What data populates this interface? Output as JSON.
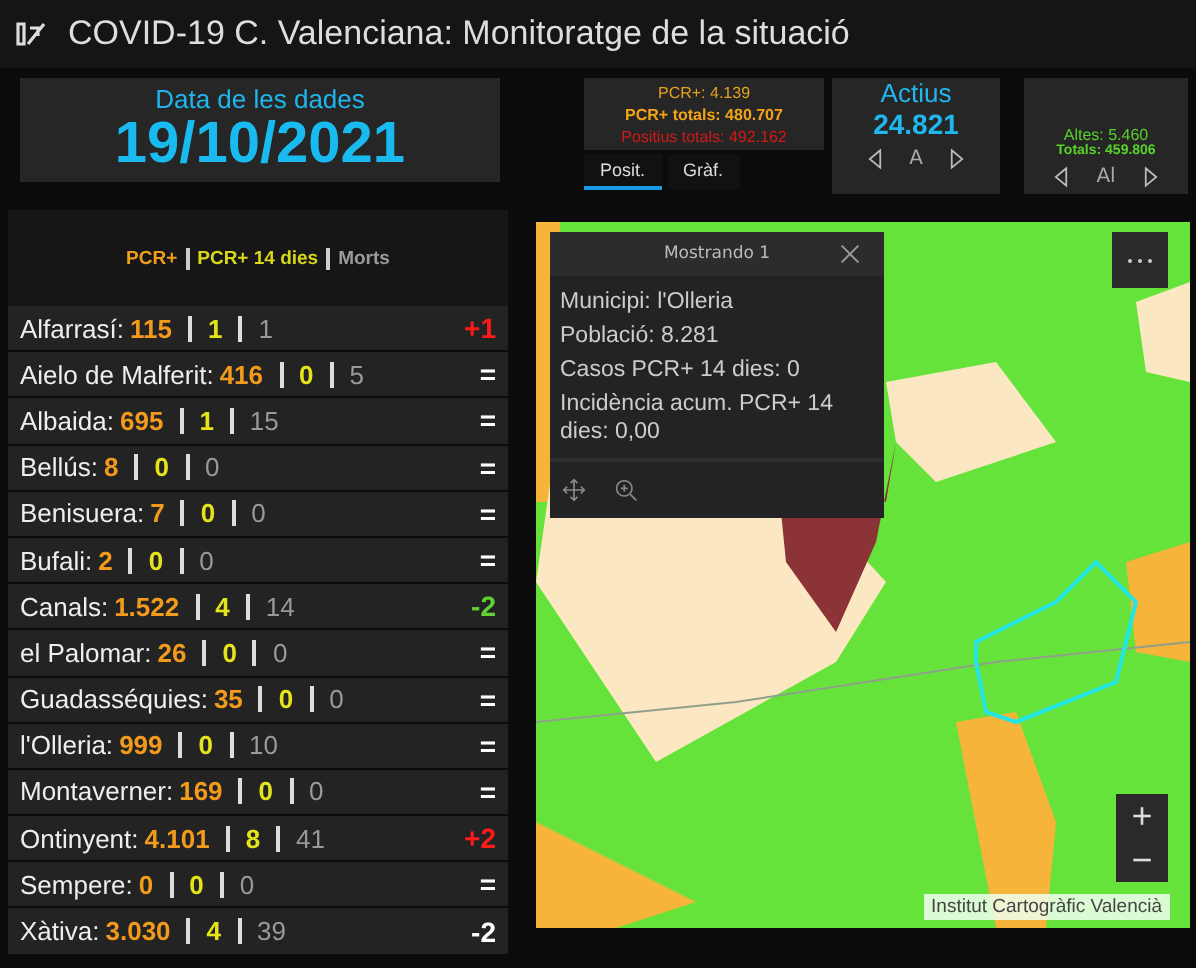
{
  "window": {
    "title": "COVID-19 C. Valenciana: Monitoratge de la situació"
  },
  "date_card": {
    "label": "Data de les dades",
    "value": "19/10/2021"
  },
  "pcr_card": {
    "lines": [
      {
        "text": "PCR+: 4.139",
        "kind": "pcr"
      },
      {
        "text": "PCR+ totals: 480.707",
        "kind": "pcr_total"
      },
      {
        "text": "Positius totals: 492.162",
        "kind": "positive"
      }
    ],
    "tabs": [
      {
        "label": "Posit.",
        "selected": true
      },
      {
        "label": "Gràf.",
        "selected": false
      }
    ]
  },
  "active_card": {
    "label": "Actius",
    "value": "24.821",
    "nav_label": "A"
  },
  "discharge_card": {
    "lines": [
      "Altes: 5.460",
      "Totals: 459.806"
    ],
    "nav_label": "Al"
  },
  "legend": [
    "PCR+",
    "PCR+ 14 dies",
    "Morts"
  ],
  "municipalities": [
    {
      "name": "Alfarrasí:",
      "pcr": "115",
      "pcr14": "1",
      "deaths": "1",
      "change": "+1",
      "color": "#ff1a1a"
    },
    {
      "name": "Aielo de Malferit:",
      "pcr": "416",
      "pcr14": "0",
      "deaths": "5",
      "change": "=",
      "color": "#ffffff"
    },
    {
      "name": "Albaida:",
      "pcr": "695",
      "pcr14": "1",
      "deaths": "15",
      "change": "=",
      "color": "#ffffff"
    },
    {
      "name": "Bellús:",
      "pcr": "8",
      "pcr14": "0",
      "deaths": "0",
      "change": "=",
      "color": "#ffffff"
    },
    {
      "name": "Benisuera:",
      "pcr": "7",
      "pcr14": "0",
      "deaths": "0",
      "change": "=",
      "color": "#ffffff"
    },
    {
      "name": "Bufali:",
      "pcr": "2",
      "pcr14": "0",
      "deaths": "0",
      "change": "=",
      "color": "#ffffff"
    },
    {
      "name": "Canals:",
      "pcr": "1.522",
      "pcr14": "4",
      "deaths": "14",
      "change": "-2",
      "color": "#5fd130"
    },
    {
      "name": "el Palomar:",
      "pcr": "26",
      "pcr14": "0",
      "deaths": "0",
      "change": "=",
      "color": "#ffffff"
    },
    {
      "name": "Guadasséquies:",
      "pcr": "35",
      "pcr14": "0",
      "deaths": "0",
      "change": "=",
      "color": "#ffffff"
    },
    {
      "name": "l'Olleria:",
      "pcr": "999",
      "pcr14": "0",
      "deaths": "10",
      "change": "=",
      "color": "#ffffff"
    },
    {
      "name": "Montaverner:",
      "pcr": "169",
      "pcr14": "0",
      "deaths": "0",
      "change": "=",
      "color": "#ffffff"
    },
    {
      "name": "Ontinyent:",
      "pcr": "4.101",
      "pcr14": "8",
      "deaths": "41",
      "change": "+2",
      "color": "#ff1a1a"
    },
    {
      "name": "Sempere:",
      "pcr": "0",
      "pcr14": "0",
      "deaths": "0",
      "change": "=",
      "color": "#ffffff"
    },
    {
      "name": "Xàtiva:",
      "pcr": "3.030",
      "pcr14": "4",
      "deaths": "39",
      "change": "-2",
      "color": "#ffffff"
    }
  ],
  "map": {
    "popup": {
      "title": "Mostrando 1",
      "lines": [
        "Municipi: l'Olleria",
        "Població: 8.281",
        "Casos PCR+ 14 dies: 0",
        "Incidència acum. PCR+ 14 dies: 0,00"
      ]
    },
    "zoom_in": "+",
    "zoom_out": "−",
    "attribution": "Institut Cartogràfic Valencià"
  }
}
